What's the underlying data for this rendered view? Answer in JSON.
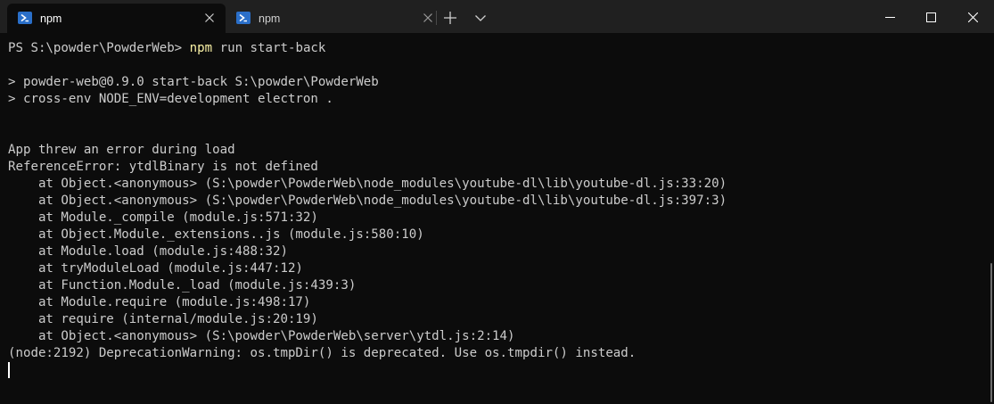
{
  "tabs": [
    {
      "title": "npm",
      "active": true
    },
    {
      "title": "npm",
      "active": false
    }
  ],
  "icons": {
    "tab_icon": "powershell-icon",
    "tab_close": "close-icon",
    "new_tab": "plus-icon",
    "dropdown": "chevron-down-icon",
    "minimize": "minimize-icon",
    "maximize": "maximize-icon",
    "close": "close-icon"
  },
  "colors": {
    "background": "#0c0c0c",
    "tabbar": "#202020",
    "text": "#cccccc",
    "command": "#f9f1a5",
    "powershell_blue": "#2a6fc9"
  },
  "terminal": {
    "prompt": "PS S:\\powder\\PowderWeb> ",
    "command_name": "npm",
    "command_args": " run start-back",
    "lines": [
      "",
      "> powder-web@0.9.0 start-back S:\\powder\\PowderWeb",
      "> cross-env NODE_ENV=development electron .",
      "",
      "",
      "App threw an error during load",
      "ReferenceError: ytdlBinary is not defined",
      "    at Object.<anonymous> (S:\\powder\\PowderWeb\\node_modules\\youtube-dl\\lib\\youtube-dl.js:33:20)",
      "    at Object.<anonymous> (S:\\powder\\PowderWeb\\node_modules\\youtube-dl\\lib\\youtube-dl.js:397:3)",
      "    at Module._compile (module.js:571:32)",
      "    at Object.Module._extensions..js (module.js:580:10)",
      "    at Module.load (module.js:488:32)",
      "    at tryModuleLoad (module.js:447:12)",
      "    at Function.Module._load (module.js:439:3)",
      "    at Module.require (module.js:498:17)",
      "    at require (internal/module.js:20:19)",
      "    at Object.<anonymous> (S:\\powder\\PowderWeb\\server\\ytdl.js:2:14)",
      "(node:2192) DeprecationWarning: os.tmpDir() is deprecated. Use os.tmpdir() instead."
    ]
  }
}
